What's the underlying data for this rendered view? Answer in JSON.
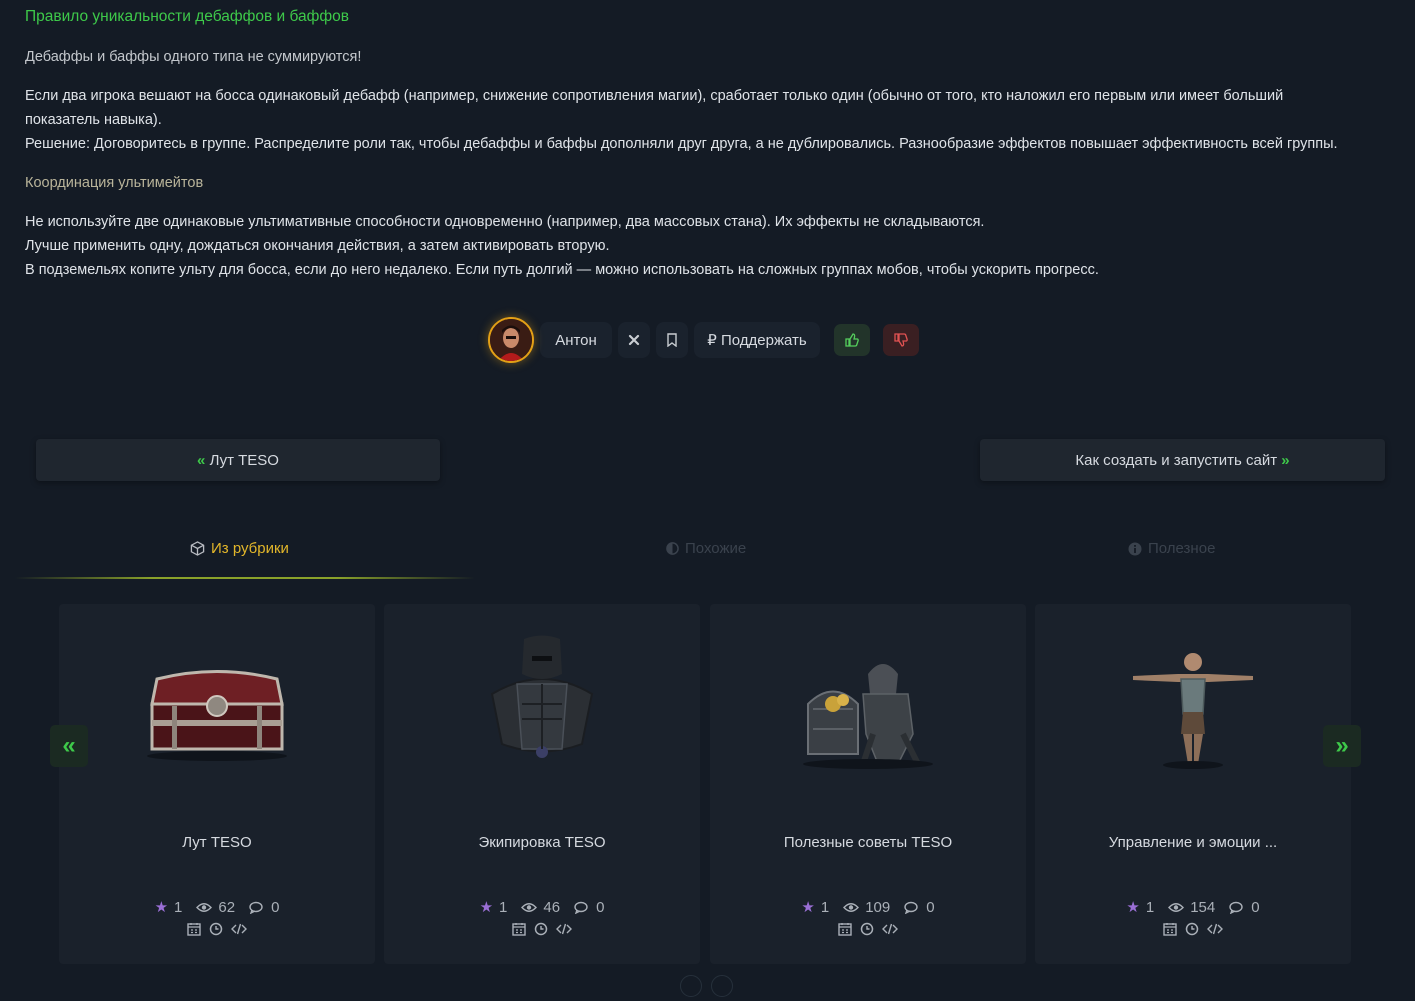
{
  "article": {
    "heading": "Правило уникальности дебаффов и баффов",
    "subheading1": "Дебаффы и баффы одного типа не суммируются!",
    "para1_line1": "Если два игрока вешают на босса одинаковый дебафф (например, снижение сопротивления магии), сработает только один (обычно от того, кто наложил его первым или имеет больший",
    "para1_line2": "показатель навыка).",
    "para1_line3": "Решение: Договоритесь в группе. Распределите роли так, чтобы дебаффы и баффы дополняли друг друга, а не дублировались. Разнообразие эффектов повышает эффективность всей группы.",
    "subheading2": "Координация ультимейтов",
    "para2_line1": "Не используйте две одинаковые ультимативные способности одновременно (например, два массовых стана). Их эффекты не складываются.",
    "para2_line2": "Лучше применить одну, дождаться окончания действия, а затем активировать вторую.",
    "para2_line3": "В подземельях копите ульту для босса, если до него недалеко. Если путь долгий — можно использовать на сложных группах мобов, чтобы ускорить прогресс."
  },
  "author_bar": {
    "author_name": "Антон",
    "support_label": "₽ Поддержать",
    "icons": [
      "avatar",
      "x-icon",
      "bookmark-icon",
      "thumbs-up-icon",
      "thumbs-down-icon"
    ]
  },
  "pagination": {
    "prev_arrow": "«",
    "prev_label": "Лут TESO",
    "next_label": "Как создать и запустить сайт",
    "next_arrow": "»"
  },
  "tabs": [
    {
      "label": "Из рубрики",
      "icon": "cube-icon",
      "active": true
    },
    {
      "label": "Похожие",
      "icon": "half-circle-icon",
      "active": false
    },
    {
      "label": "Полезное",
      "icon": "info-circle-icon",
      "active": false
    }
  ],
  "slider": {
    "prev_arrow": "«",
    "next_arrow": "»",
    "cards": [
      {
        "title": "Лут TESO",
        "rating": "1",
        "views": "62",
        "comments": "0",
        "image": "treasure-chest"
      },
      {
        "title": "Экипировка TESO",
        "rating": "1",
        "views": "46",
        "comments": "0",
        "image": "dark-armor"
      },
      {
        "title": "Полезные советы TESO",
        "rating": "1",
        "views": "109",
        "comments": "0",
        "image": "knight-with-chest"
      },
      {
        "title": "Управление и эмоции ...",
        "rating": "1",
        "views": "154",
        "comments": "0",
        "image": "t-pose-character"
      }
    ]
  },
  "colors": {
    "background": "#141b25",
    "accent_green": "#3ec94a",
    "accent_gold": "#e2b62a",
    "star_purple": "#9a6fd6"
  }
}
